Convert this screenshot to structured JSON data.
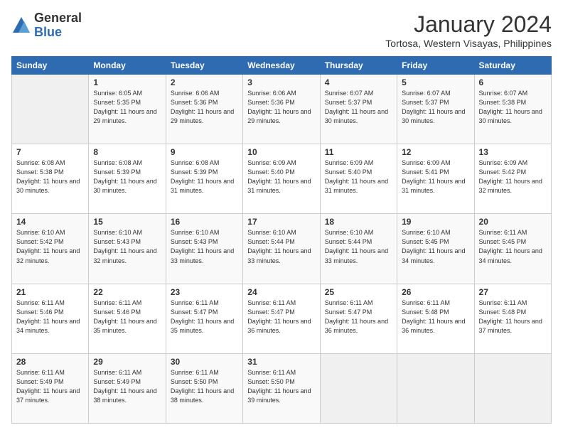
{
  "logo": {
    "general": "General",
    "blue": "Blue"
  },
  "header": {
    "month": "January 2024",
    "location": "Tortosa, Western Visayas, Philippines"
  },
  "weekdays": [
    "Sunday",
    "Monday",
    "Tuesday",
    "Wednesday",
    "Thursday",
    "Friday",
    "Saturday"
  ],
  "weeks": [
    [
      {
        "day": "",
        "sunrise": "",
        "sunset": "",
        "daylight": ""
      },
      {
        "day": "1",
        "sunrise": "Sunrise: 6:05 AM",
        "sunset": "Sunset: 5:35 PM",
        "daylight": "Daylight: 11 hours and 29 minutes."
      },
      {
        "day": "2",
        "sunrise": "Sunrise: 6:06 AM",
        "sunset": "Sunset: 5:36 PM",
        "daylight": "Daylight: 11 hours and 29 minutes."
      },
      {
        "day": "3",
        "sunrise": "Sunrise: 6:06 AM",
        "sunset": "Sunset: 5:36 PM",
        "daylight": "Daylight: 11 hours and 29 minutes."
      },
      {
        "day": "4",
        "sunrise": "Sunrise: 6:07 AM",
        "sunset": "Sunset: 5:37 PM",
        "daylight": "Daylight: 11 hours and 30 minutes."
      },
      {
        "day": "5",
        "sunrise": "Sunrise: 6:07 AM",
        "sunset": "Sunset: 5:37 PM",
        "daylight": "Daylight: 11 hours and 30 minutes."
      },
      {
        "day": "6",
        "sunrise": "Sunrise: 6:07 AM",
        "sunset": "Sunset: 5:38 PM",
        "daylight": "Daylight: 11 hours and 30 minutes."
      }
    ],
    [
      {
        "day": "7",
        "sunrise": "Sunrise: 6:08 AM",
        "sunset": "Sunset: 5:38 PM",
        "daylight": "Daylight: 11 hours and 30 minutes."
      },
      {
        "day": "8",
        "sunrise": "Sunrise: 6:08 AM",
        "sunset": "Sunset: 5:39 PM",
        "daylight": "Daylight: 11 hours and 30 minutes."
      },
      {
        "day": "9",
        "sunrise": "Sunrise: 6:08 AM",
        "sunset": "Sunset: 5:39 PM",
        "daylight": "Daylight: 11 hours and 31 minutes."
      },
      {
        "day": "10",
        "sunrise": "Sunrise: 6:09 AM",
        "sunset": "Sunset: 5:40 PM",
        "daylight": "Daylight: 11 hours and 31 minutes."
      },
      {
        "day": "11",
        "sunrise": "Sunrise: 6:09 AM",
        "sunset": "Sunset: 5:40 PM",
        "daylight": "Daylight: 11 hours and 31 minutes."
      },
      {
        "day": "12",
        "sunrise": "Sunrise: 6:09 AM",
        "sunset": "Sunset: 5:41 PM",
        "daylight": "Daylight: 11 hours and 31 minutes."
      },
      {
        "day": "13",
        "sunrise": "Sunrise: 6:09 AM",
        "sunset": "Sunset: 5:42 PM",
        "daylight": "Daylight: 11 hours and 32 minutes."
      }
    ],
    [
      {
        "day": "14",
        "sunrise": "Sunrise: 6:10 AM",
        "sunset": "Sunset: 5:42 PM",
        "daylight": "Daylight: 11 hours and 32 minutes."
      },
      {
        "day": "15",
        "sunrise": "Sunrise: 6:10 AM",
        "sunset": "Sunset: 5:43 PM",
        "daylight": "Daylight: 11 hours and 32 minutes."
      },
      {
        "day": "16",
        "sunrise": "Sunrise: 6:10 AM",
        "sunset": "Sunset: 5:43 PM",
        "daylight": "Daylight: 11 hours and 33 minutes."
      },
      {
        "day": "17",
        "sunrise": "Sunrise: 6:10 AM",
        "sunset": "Sunset: 5:44 PM",
        "daylight": "Daylight: 11 hours and 33 minutes."
      },
      {
        "day": "18",
        "sunrise": "Sunrise: 6:10 AM",
        "sunset": "Sunset: 5:44 PM",
        "daylight": "Daylight: 11 hours and 33 minutes."
      },
      {
        "day": "19",
        "sunrise": "Sunrise: 6:10 AM",
        "sunset": "Sunset: 5:45 PM",
        "daylight": "Daylight: 11 hours and 34 minutes."
      },
      {
        "day": "20",
        "sunrise": "Sunrise: 6:11 AM",
        "sunset": "Sunset: 5:45 PM",
        "daylight": "Daylight: 11 hours and 34 minutes."
      }
    ],
    [
      {
        "day": "21",
        "sunrise": "Sunrise: 6:11 AM",
        "sunset": "Sunset: 5:46 PM",
        "daylight": "Daylight: 11 hours and 34 minutes."
      },
      {
        "day": "22",
        "sunrise": "Sunrise: 6:11 AM",
        "sunset": "Sunset: 5:46 PM",
        "daylight": "Daylight: 11 hours and 35 minutes."
      },
      {
        "day": "23",
        "sunrise": "Sunrise: 6:11 AM",
        "sunset": "Sunset: 5:47 PM",
        "daylight": "Daylight: 11 hours and 35 minutes."
      },
      {
        "day": "24",
        "sunrise": "Sunrise: 6:11 AM",
        "sunset": "Sunset: 5:47 PM",
        "daylight": "Daylight: 11 hours and 36 minutes."
      },
      {
        "day": "25",
        "sunrise": "Sunrise: 6:11 AM",
        "sunset": "Sunset: 5:47 PM",
        "daylight": "Daylight: 11 hours and 36 minutes."
      },
      {
        "day": "26",
        "sunrise": "Sunrise: 6:11 AM",
        "sunset": "Sunset: 5:48 PM",
        "daylight": "Daylight: 11 hours and 36 minutes."
      },
      {
        "day": "27",
        "sunrise": "Sunrise: 6:11 AM",
        "sunset": "Sunset: 5:48 PM",
        "daylight": "Daylight: 11 hours and 37 minutes."
      }
    ],
    [
      {
        "day": "28",
        "sunrise": "Sunrise: 6:11 AM",
        "sunset": "Sunset: 5:49 PM",
        "daylight": "Daylight: 11 hours and 37 minutes."
      },
      {
        "day": "29",
        "sunrise": "Sunrise: 6:11 AM",
        "sunset": "Sunset: 5:49 PM",
        "daylight": "Daylight: 11 hours and 38 minutes."
      },
      {
        "day": "30",
        "sunrise": "Sunrise: 6:11 AM",
        "sunset": "Sunset: 5:50 PM",
        "daylight": "Daylight: 11 hours and 38 minutes."
      },
      {
        "day": "31",
        "sunrise": "Sunrise: 6:11 AM",
        "sunset": "Sunset: 5:50 PM",
        "daylight": "Daylight: 11 hours and 39 minutes."
      },
      {
        "day": "",
        "sunrise": "",
        "sunset": "",
        "daylight": ""
      },
      {
        "day": "",
        "sunrise": "",
        "sunset": "",
        "daylight": ""
      },
      {
        "day": "",
        "sunrise": "",
        "sunset": "",
        "daylight": ""
      }
    ]
  ]
}
